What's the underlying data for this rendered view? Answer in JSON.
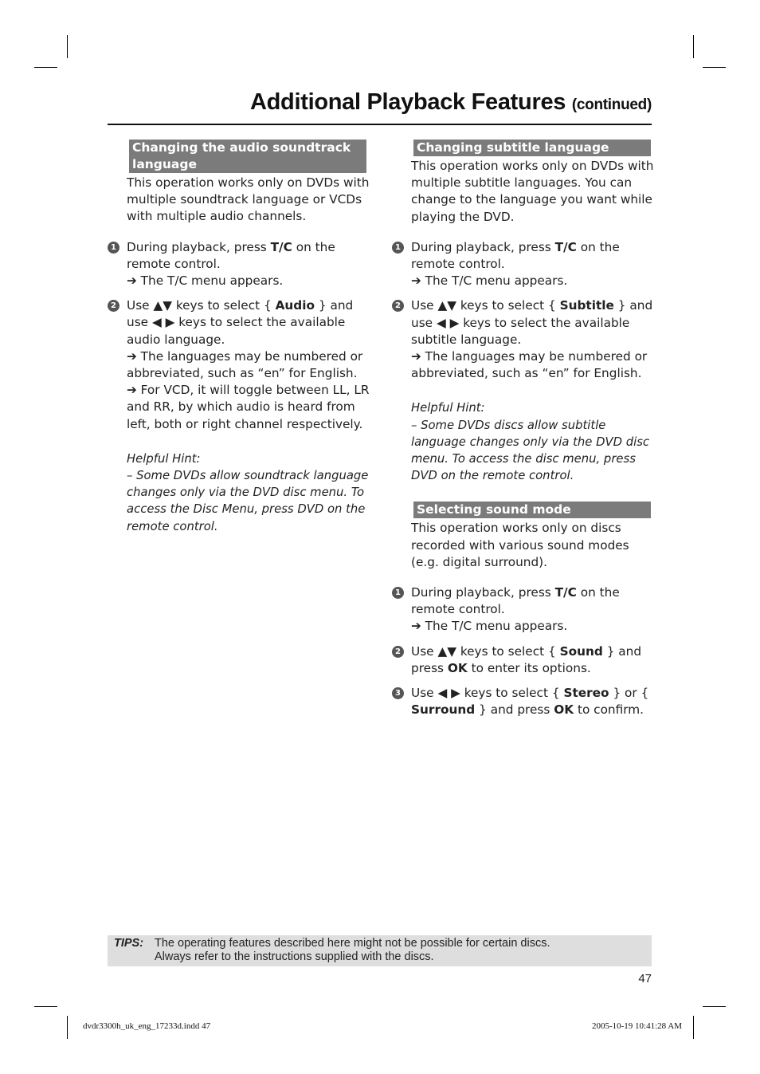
{
  "header": {
    "title": "Additional Playback Features",
    "continued": "(continued)"
  },
  "left": {
    "heading": "Changing the audio soundtrack language",
    "intro": "This operation works only on DVDs with multiple soundtrack language or VCDs with multiple audio channels.",
    "steps": [
      {
        "num": "1",
        "pre": "During playback, press ",
        "key": "T/C",
        "post": " on the remote control.",
        "results": [
          "➔ The T/C menu appears."
        ]
      },
      {
        "num": "2",
        "pre": "Use ▲▼ keys to select { ",
        "key": "Audio",
        "post": " } and use ◀ ▶ keys to select the available audio language.",
        "results": [
          "➔ The languages may be numbered or abbreviated, such as “en” for English.",
          "➔ For VCD, it will toggle between LL, LR and RR, by which audio is heard from left, both or right channel respectively."
        ]
      }
    ],
    "hint_title": "Helpful Hint:",
    "hint_text": "–  Some DVDs allow soundtrack language changes only via the DVD disc menu. To access the Disc Menu, press DVD on the remote control."
  },
  "right": {
    "subtitle": {
      "heading": "Changing subtitle language",
      "intro": "This operation works only on DVDs with multiple subtitle languages.  You can change to the language you want while playing the DVD.",
      "steps": [
        {
          "num": "1",
          "pre": "During playback, press ",
          "key": "T/C",
          "post": " on the remote control.",
          "results": [
            "➔ The T/C menu appears."
          ]
        },
        {
          "num": "2",
          "pre": "Use ▲▼ keys to select { ",
          "key": "Subtitle",
          "post": " } and use ◀ ▶ keys to select the available subtitle language.",
          "results": [
            "➔ The languages may be numbered or abbreviated, such as “en” for English."
          ]
        }
      ],
      "hint_title": "Helpful Hint:",
      "hint_text": "–  Some DVDs discs allow subtitle language changes only via the DVD disc menu. To access the disc menu, press DVD on the remote control."
    },
    "sound": {
      "heading": "Selecting sound mode",
      "intro": "This operation works only on discs recorded with various sound modes (e.g. digital surround).",
      "step1": {
        "num": "1",
        "pre": "During playback, press ",
        "key": "T/C",
        "post": " on the remote control.",
        "result": "➔ The T/C menu appears."
      },
      "step2": {
        "num": "2",
        "pre": "Use ▲▼ keys to select { ",
        "key": "Sound",
        "mid": " } and press ",
        "key2": "OK",
        "post": " to enter its options."
      },
      "step3": {
        "num": "3",
        "pre": "Use ◀ ▶ keys to select { ",
        "key": "Stereo",
        "mid": " } or { ",
        "key2": "Surround",
        "mid2": " } and press ",
        "key3": "OK",
        "post": " to confirm."
      }
    }
  },
  "tips": {
    "label": "TIPS:",
    "line1": "The operating features described here might not be possible for certain discs.",
    "line2": "Always refer to the instructions supplied with the discs."
  },
  "page_number": "47",
  "slug": {
    "file": "dvdr3300h_uk_eng_17233d.indd   47",
    "timestamp": "2005-10-19   10:41:28 AM"
  }
}
